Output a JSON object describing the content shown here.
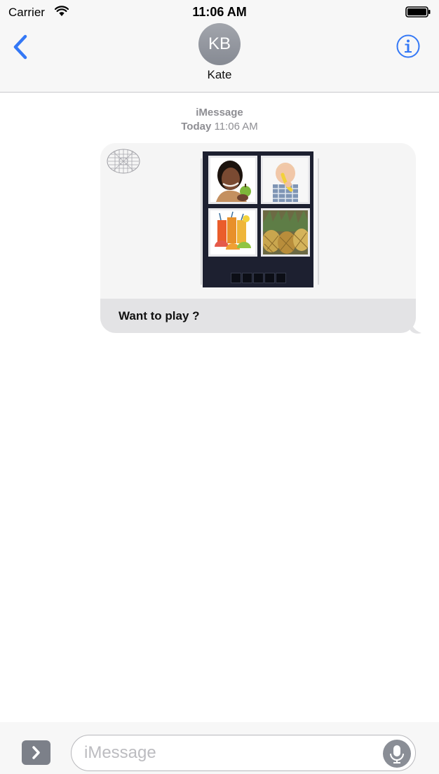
{
  "status_bar": {
    "carrier": "Carrier",
    "time": "11:06 AM"
  },
  "nav": {
    "avatar_initials": "KB",
    "contact_name": "Kate"
  },
  "thread": {
    "service_label": "iMessage",
    "day_label": "Today",
    "time_label": "11:06 AM"
  },
  "message": {
    "caption": "Want to play  ?",
    "game_slot_count": 5
  },
  "input": {
    "placeholder": "iMessage"
  },
  "colors": {
    "accent": "#3478f6",
    "bubble": "#f5f5f5",
    "caption_bg": "#e3e3e5",
    "game_board": "#1d2030"
  },
  "icons": [
    "signal-wifi-icon",
    "battery-icon",
    "chevron-left-icon",
    "info-icon",
    "app-store-icon",
    "microphone-icon"
  ]
}
